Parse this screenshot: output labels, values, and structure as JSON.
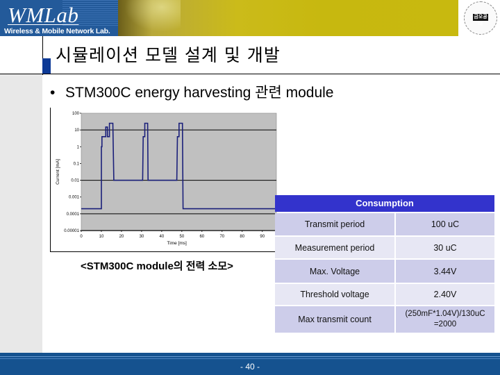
{
  "header": {
    "brand_title": "WMLab",
    "brand_subtitle": "Wireless & Mobile Network Lab.",
    "seal_text": "금오공대"
  },
  "slide": {
    "title": "시뮬레이션 모델 설계 및 개발",
    "bullet_marker": "•",
    "bullet_text": "STM300C energy harvesting 관련 module",
    "caption": "<STM300C module의 전력 소모>"
  },
  "chart_data": {
    "type": "line",
    "title": "",
    "xlabel": "Time [ms]",
    "ylabel": "Current [mA]",
    "y_scale": "log",
    "ylim": [
      1e-05,
      100
    ],
    "xlim": [
      0,
      97
    ],
    "x_ticks": [
      "0",
      "10",
      "20",
      "30",
      "40",
      "50",
      "60",
      "70",
      "80",
      "90"
    ],
    "y_ticks": [
      "100",
      "10",
      "1",
      "0.1",
      "0.01",
      "0.001",
      "0.0001",
      "0.00001"
    ],
    "gridlines_y": [
      10,
      0.01,
      0.0001
    ],
    "plot_background": "#c0c0c0",
    "line_color": "#1a1f7a",
    "series": [
      {
        "name": "Current",
        "points": [
          [
            0,
            0.0002
          ],
          [
            10,
            0.0002
          ],
          [
            10,
            1
          ],
          [
            10.3,
            1
          ],
          [
            10.3,
            4
          ],
          [
            12.2,
            4
          ],
          [
            12.2,
            15
          ],
          [
            13,
            15
          ],
          [
            13,
            4
          ],
          [
            14,
            4
          ],
          [
            14,
            25
          ],
          [
            15.7,
            25
          ],
          [
            16.2,
            0.01
          ],
          [
            30.5,
            0.01
          ],
          [
            30.8,
            4
          ],
          [
            31.6,
            4
          ],
          [
            31.6,
            25
          ],
          [
            33,
            25
          ],
          [
            33.2,
            0.01
          ],
          [
            47.5,
            0.01
          ],
          [
            47.8,
            4
          ],
          [
            48.6,
            4
          ],
          [
            48.6,
            25
          ],
          [
            50.3,
            25
          ],
          [
            50.6,
            0.0002
          ],
          [
            97,
            0.0002
          ]
        ]
      }
    ]
  },
  "table": {
    "header": "Consumption",
    "rows": [
      {
        "label": "Transmit  period",
        "value": "100 uC"
      },
      {
        "label": "Measurement period",
        "value": "30 uC"
      },
      {
        "label": "Max. Voltage",
        "value": "3.44V"
      },
      {
        "label": "Threshold voltage",
        "value": "2.40V"
      },
      {
        "label": "Max transmit count",
        "value_line1": "(250mF*1.04V)/130uC",
        "value_line2": "=2000"
      }
    ]
  },
  "footer": {
    "page_number": "- 40 -"
  }
}
